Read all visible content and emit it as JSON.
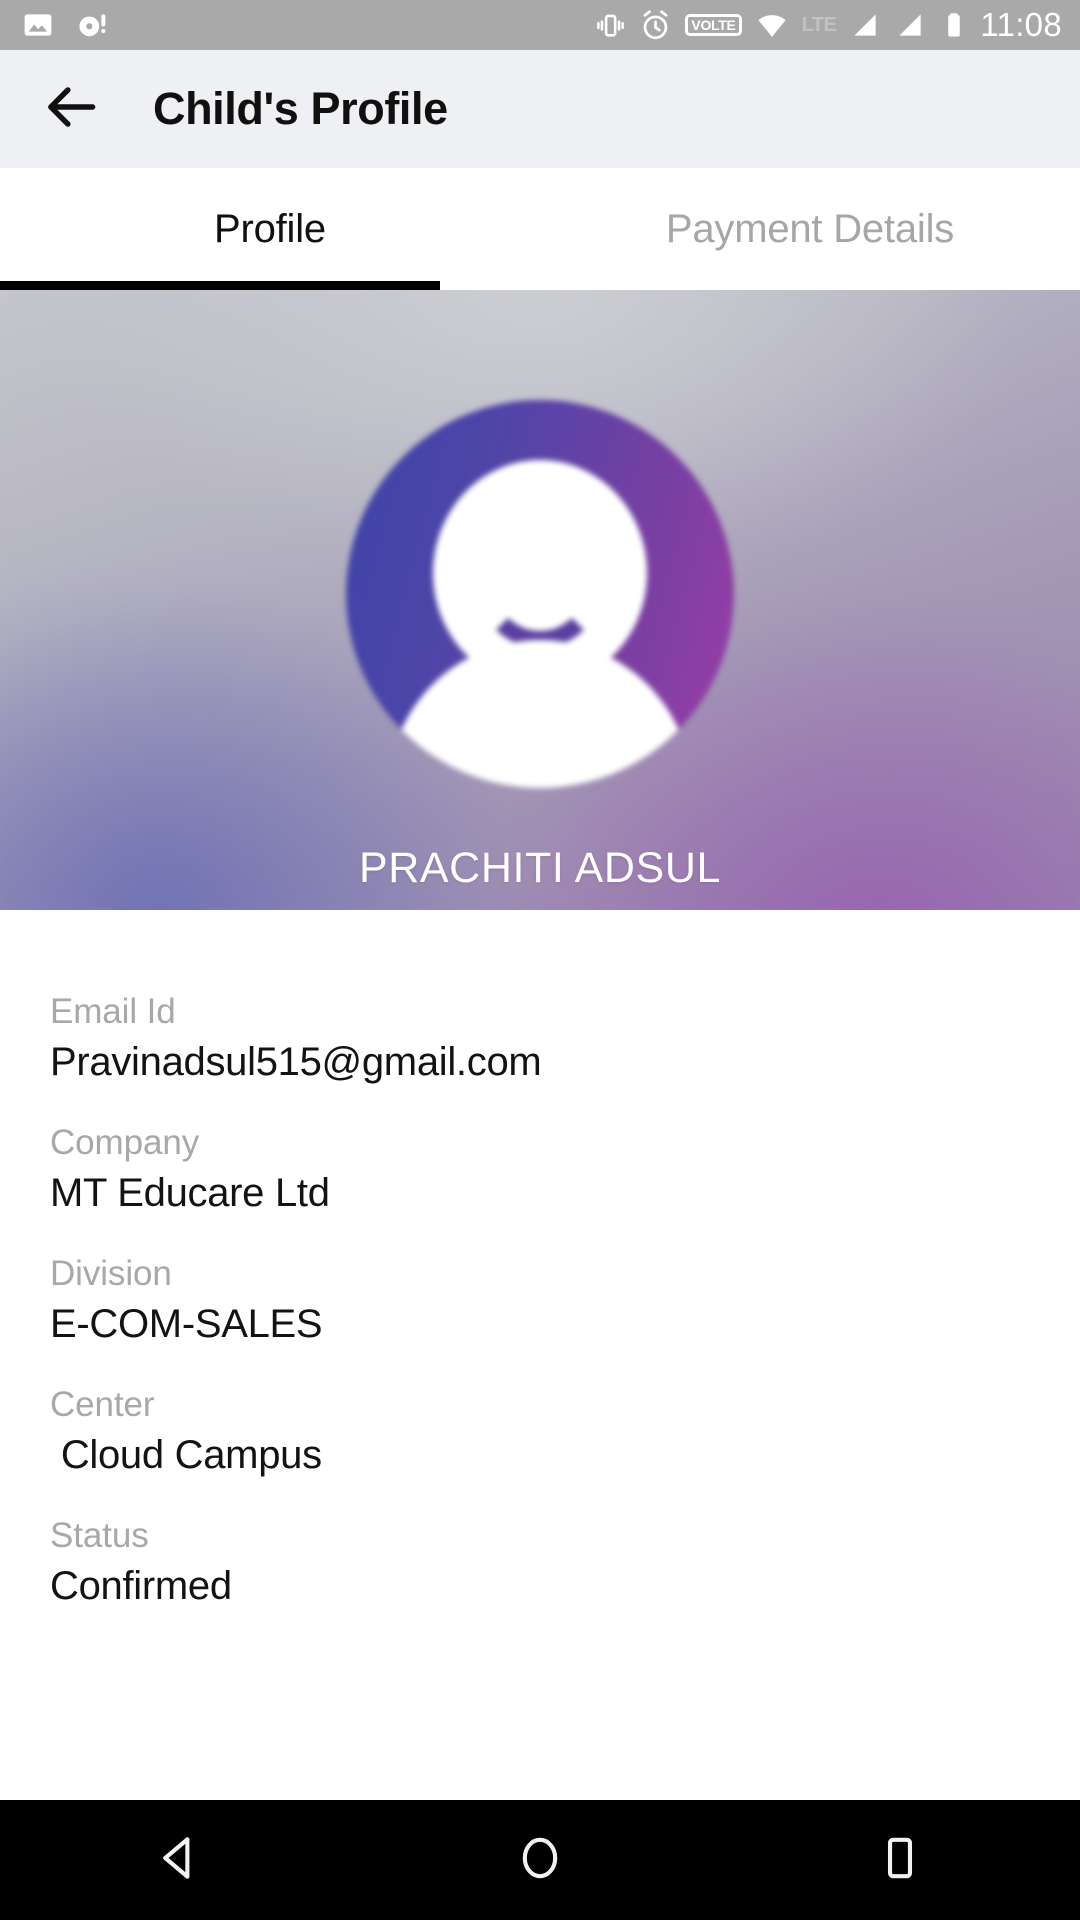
{
  "status_bar": {
    "time": "11:08",
    "volte_label": "VOLTE",
    "network_label": "LTE",
    "left_icons": [
      "image-icon",
      "disc-alert-icon"
    ],
    "right_icons": [
      "vibrate-icon",
      "alarm-icon",
      "volte-icon",
      "wifi-icon",
      "lte-icon",
      "signal-one-icon",
      "signal-two-icon",
      "battery-icon"
    ],
    "background_color": "#a9a9a9"
  },
  "app_bar": {
    "title": "Child's Profile",
    "back_icon": "arrow-left-icon",
    "background_color": "#eef0f4"
  },
  "tabs": {
    "items": [
      {
        "label": "Profile",
        "active": true
      },
      {
        "label": "Payment Details",
        "active": false
      }
    ],
    "indicator_color": "#000000",
    "active_color": "#111111",
    "inactive_color": "#a6a6a6"
  },
  "hero": {
    "name": "PRACHITI ADSUL",
    "avatar_icon": "user-smiley-avatar-icon",
    "avatar_gradient_start": "#3f44a8",
    "avatar_gradient_end": "#9c3ea6",
    "background_gradient_start": "#c9cace",
    "background_gradient_end": "#9a86ad"
  },
  "details": {
    "fields": [
      {
        "label": "Email Id",
        "value": "Pravinadsul515@gmail.com"
      },
      {
        "label": "Company",
        "value": "MT Educare Ltd"
      },
      {
        "label": "Division",
        "value": "E-COM-SALES"
      },
      {
        "label": "Center",
        "value": " Cloud Campus"
      },
      {
        "label": "Status",
        "value": "Confirmed"
      }
    ],
    "label_color": "#a8a8a8",
    "value_color": "#131313"
  },
  "nav_bar": {
    "buttons": [
      {
        "name": "back-triangle-icon"
      },
      {
        "name": "home-circle-icon"
      },
      {
        "name": "recents-square-icon"
      }
    ],
    "background_color": "#000000"
  }
}
